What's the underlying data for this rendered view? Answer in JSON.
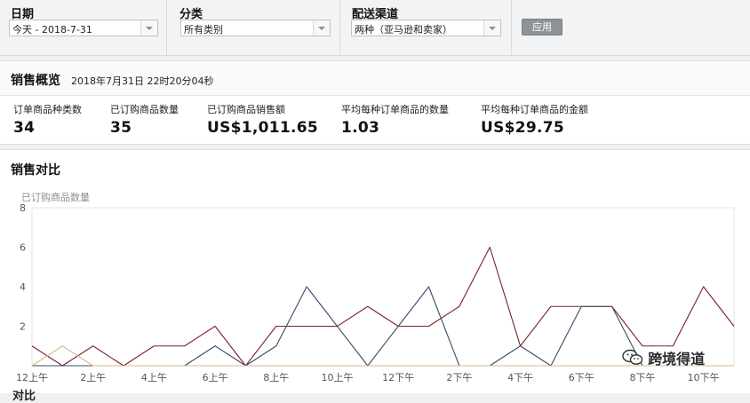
{
  "filters": {
    "date": {
      "label": "日期",
      "value": "今天 - 2018-7-31"
    },
    "category": {
      "label": "分类",
      "value": "所有类别"
    },
    "channel": {
      "label": "配送渠道",
      "value": "两种（亚马逊和卖家）"
    },
    "apply_label": "应用"
  },
  "overview": {
    "title": "销售概览",
    "timestamp": "2018年7月31日 22时20分04秒",
    "metrics": [
      {
        "label": "订单商品种类数",
        "value": "34"
      },
      {
        "label": "已订购商品数量",
        "value": "35"
      },
      {
        "label": "已订购商品销售额",
        "value": "US$1,011.65"
      },
      {
        "label": "平均每种订单商品的数量",
        "value": "1.03"
      },
      {
        "label": "平均每种订单商品的金额",
        "value": "US$29.75"
      }
    ]
  },
  "comparison": {
    "title": "销售对比",
    "cut_off_text": "对比"
  },
  "chart_data": {
    "type": "line",
    "ylabel": "已订购商品数量",
    "ylim": [
      0,
      8
    ],
    "yticks": [
      2,
      4,
      6,
      8
    ],
    "x": [
      0,
      1,
      2,
      3,
      4,
      5,
      6,
      7,
      8,
      9,
      10,
      11,
      12,
      13,
      14,
      15,
      16,
      17,
      18,
      19,
      20,
      21,
      22,
      23
    ],
    "xtick_labels": [
      {
        "at": 0,
        "label": "12上午"
      },
      {
        "at": 2,
        "label": "2上午"
      },
      {
        "at": 4,
        "label": "4上午"
      },
      {
        "at": 6,
        "label": "6上午"
      },
      {
        "at": 8,
        "label": "8上午"
      },
      {
        "at": 10,
        "label": "10上午"
      },
      {
        "at": 12,
        "label": "12下午"
      },
      {
        "at": 14,
        "label": "2下午"
      },
      {
        "at": 16,
        "label": "4下午"
      },
      {
        "at": 18,
        "label": "6下午"
      },
      {
        "at": 20,
        "label": "8下午"
      },
      {
        "at": 22,
        "label": "10下午"
      }
    ],
    "grid": false,
    "series": [
      {
        "color": "#7a2030",
        "values": [
          1,
          0,
          1,
          0,
          1,
          1,
          2,
          0,
          2,
          2,
          2,
          3,
          2,
          2,
          3,
          6,
          1,
          3,
          3,
          3,
          1,
          1,
          4,
          2
        ]
      },
      {
        "color": "#3a4a66",
        "values": [
          0,
          0,
          0,
          0,
          0,
          0,
          1,
          0,
          1,
          4,
          2,
          0,
          2,
          4,
          0,
          0,
          1,
          0,
          3,
          3,
          0,
          0,
          0,
          0
        ]
      },
      {
        "color": "#d9b890",
        "values": [
          0,
          1,
          0,
          0,
          0,
          0,
          0,
          0,
          0,
          0,
          0,
          0,
          0,
          0,
          0,
          0,
          0,
          0,
          0,
          0,
          0,
          0,
          0,
          0
        ]
      }
    ]
  },
  "watermark": {
    "text": "跨境得道",
    "icon": "wechat-icon"
  }
}
